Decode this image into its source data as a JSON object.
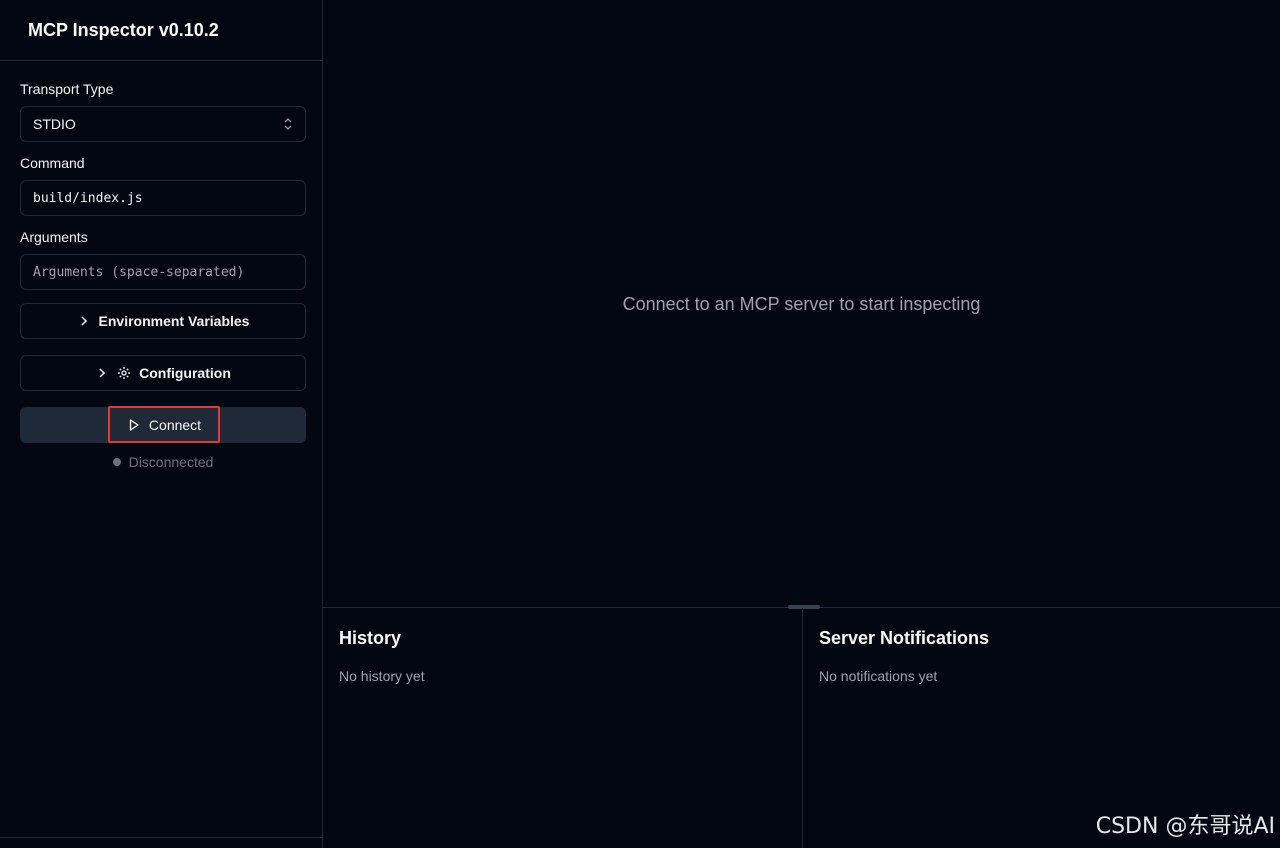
{
  "app": {
    "title": "MCP Inspector v0.10.2"
  },
  "sidebar": {
    "transport": {
      "label": "Transport Type",
      "value": "STDIO"
    },
    "command": {
      "label": "Command",
      "value": "build/index.js"
    },
    "arguments": {
      "label": "Arguments",
      "placeholder": "Arguments (space-separated)"
    },
    "env_button": "Environment Variables",
    "config_button": "Configuration",
    "connect_button": "Connect",
    "status": "Disconnected"
  },
  "main": {
    "empty_message": "Connect to an MCP server to start inspecting",
    "history": {
      "title": "History",
      "empty": "No history yet"
    },
    "notifications": {
      "title": "Server Notifications",
      "empty": "No notifications yet"
    }
  },
  "watermark": "CSDN @东哥说AI",
  "colors": {
    "background": "#030712",
    "border": "#1f2937",
    "highlight": "#e53935",
    "muted": "#9ca3af"
  },
  "icons": [
    "chevron-up-down-icon",
    "chevron-right-icon",
    "gear-icon",
    "play-icon"
  ]
}
